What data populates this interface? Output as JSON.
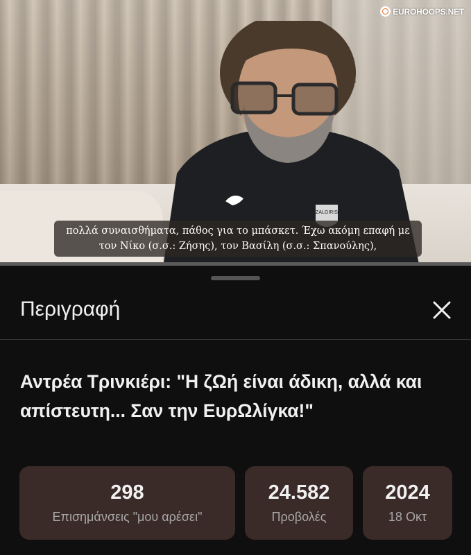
{
  "video": {
    "watermark": "EUROHOOPS.NET",
    "subtitle_line1": "πολλά συναισθήματα, πάθος για το μπάσκετ. Έχω ακόμη επαφή με",
    "subtitle_line2": "τον Νίκο (σ.σ.: Ζήσης), τον Βασίλη (σ.σ.: Σπανούλης),",
    "jersey_logo": "ZALGIRIS",
    "progress": 0
  },
  "sheet": {
    "title": "Περιγραφή",
    "close_icon": "close-icon",
    "video_title": "Αντρέα Τρινκιέρι: \"Η ζΩή είναι άδικη, αλλά και απίστευτη... Σαν την ΕυρΩλίγκα!\""
  },
  "stats": {
    "likes": {
      "value": "298",
      "label": "Επισημάνσεις \"μου αρέσει\""
    },
    "views": {
      "value": "24.582",
      "label": "Προβολές"
    },
    "date": {
      "value": "2024",
      "label": "18 Οκτ"
    }
  },
  "colors": {
    "background": "#0f0f0f",
    "stat_card": "#3a2a28",
    "text_primary": "#f1f1f1",
    "text_secondary": "#a8a8a8"
  }
}
